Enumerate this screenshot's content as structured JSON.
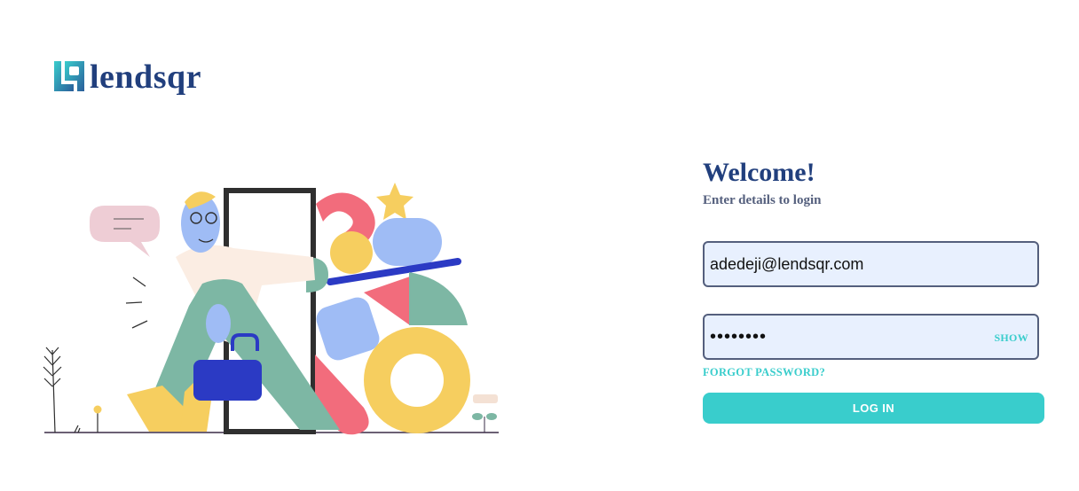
{
  "brand": {
    "name": "lendsqr",
    "logo_icon": "lendsqr-logo-mark",
    "color": "#213F7D"
  },
  "login": {
    "title": "Welcome!",
    "subtitle": "Enter details to login",
    "email_value": "adedeji@lendsqr.com",
    "password_value": "••••••••",
    "show_label": "SHOW",
    "forgot_label": "FORGOT PASSWORD?",
    "button_label": "LOG IN"
  },
  "colors": {
    "accent": "#39CDCC",
    "title": "#213F7D",
    "muted": "#545F7D",
    "input_bg": "#E8F0FE"
  },
  "illustration_icon": "person-walking-through-door-illustration"
}
